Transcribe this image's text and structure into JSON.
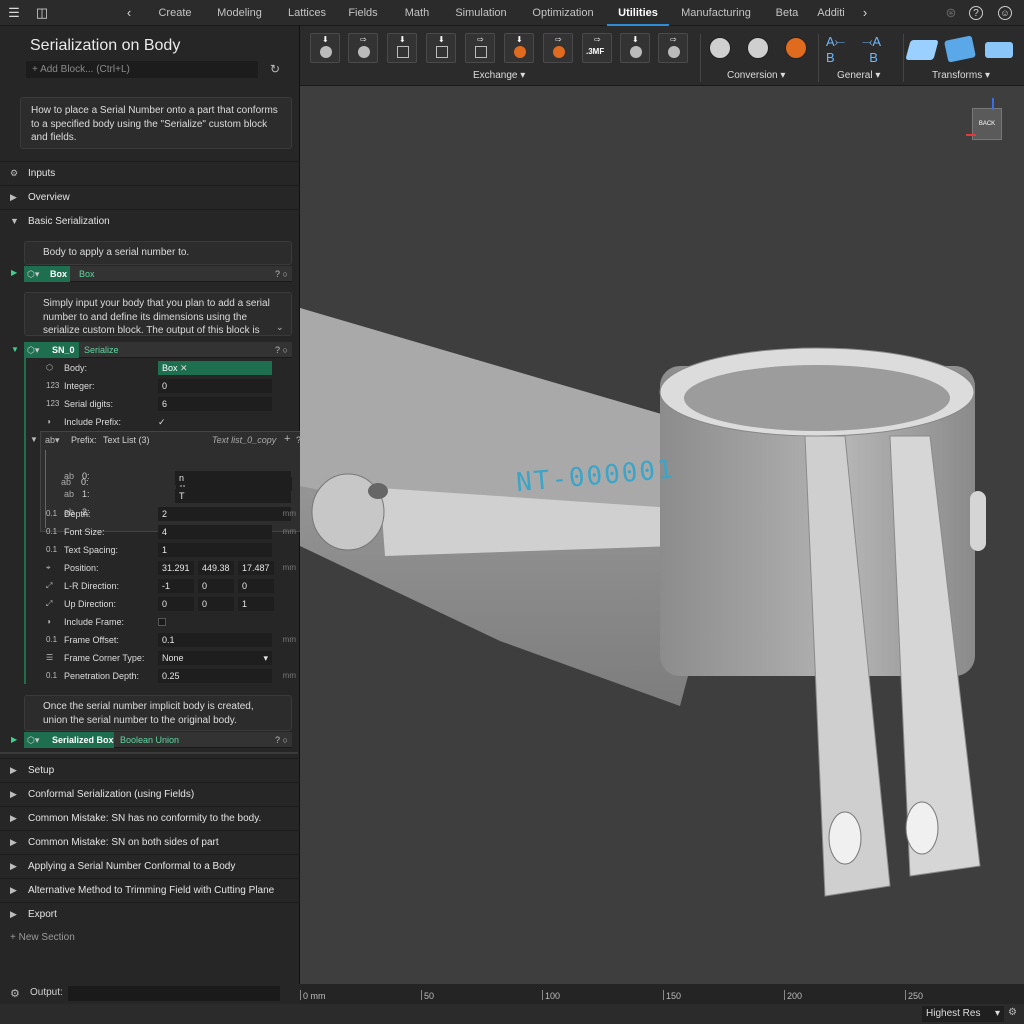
{
  "topbar": {
    "tabs": [
      "Create",
      "Modeling",
      "Lattices",
      "Fields",
      "Math",
      "Simulation",
      "Optimization",
      "Utilities",
      "Manufacturing",
      "Beta",
      "Additi"
    ],
    "active_tab": "Utilities"
  },
  "panel": {
    "title": "Serialization on Body",
    "add_block_placeholder": "Add Block... (Ctrl+L)",
    "intro": "How to place a Serial Number onto a part that conforms to a specified body using the \"Serialize\" custom block and fields.",
    "sections_top": [
      "Inputs",
      "Overview",
      "Basic Serialization"
    ],
    "card_body": "Body to apply a serial number to.",
    "box_block": {
      "name": "Box",
      "type": "Box"
    },
    "card_simply": "Simply input your body that you plan to add a serial number to and define its dimensions using the serialize custom block. The output of this block is",
    "sn_block": {
      "name": "SN_0",
      "type": "Serialize"
    },
    "props": {
      "body_label": "Body:",
      "body_value": "Box",
      "integer_label": "Integer:",
      "integer_value": "0",
      "serial_digits_label": "Serial digits:",
      "serial_digits_value": "6",
      "include_prefix_label": "Include Prefix:",
      "include_prefix_value": "✓",
      "prefix_label": "Prefix:",
      "prefix_type": "Text List (3)",
      "prefix_copy": "Text list_0_copy",
      "prefix_items": [
        {
          "label": "0:",
          "value": "n"
        },
        {
          "label": "1:",
          "value": "T"
        },
        {
          "label": "2:",
          "value": "-"
        }
      ],
      "depth_label": "Depth:",
      "depth_value": "2",
      "font_size_label": "Font Size:",
      "font_size_value": "4",
      "text_spacing_label": "Text Spacing:",
      "text_spacing_value": "1",
      "position_label": "Position:",
      "position_x": "31.291",
      "position_y": "449.38",
      "position_z": "17.487",
      "lr_label": "L-R Direction:",
      "lr_x": "-1",
      "lr_y": "0",
      "lr_z": "0",
      "up_label": "Up Direction:",
      "up_x": "0",
      "up_y": "0",
      "up_z": "1",
      "include_frame_label": "Include Frame:",
      "frame_offset_label": "Frame Offset:",
      "frame_offset_value": "0.1",
      "frame_corner_label": "Frame Corner Type:",
      "frame_corner_value": "None",
      "penetration_label": "Penetration Depth:",
      "penetration_value": "0.25",
      "unit": "mm"
    },
    "card_once": "Once the serial number implicit body is created, union the serial number to the original body.",
    "serialized_block": {
      "name": "Serialized Box",
      "type": "Boolean Union"
    },
    "sections_bottom": [
      "Setup",
      "Conformal Serialization (using Fields)",
      "Common Mistake: SN has no conformity to the body.",
      "Common Mistake: SN on both sides of part",
      "Applying a Serial Number Conformal to a Body",
      "Alternative Method to Trimming Field with Cutting Plane",
      "Export"
    ],
    "new_section": "New Section",
    "output_label": "Output:"
  },
  "ribbon": {
    "groups": [
      "Exchange",
      "Conversion",
      "General",
      "Transforms"
    ],
    "threemf": ".3MF"
  },
  "viewport": {
    "serial_text": "NT-000001",
    "viewcube_label": "BACK",
    "quality": "Highest Res"
  },
  "ruler": {
    "ticks": [
      "0 mm",
      "50",
      "100",
      "150",
      "200",
      "250"
    ]
  }
}
